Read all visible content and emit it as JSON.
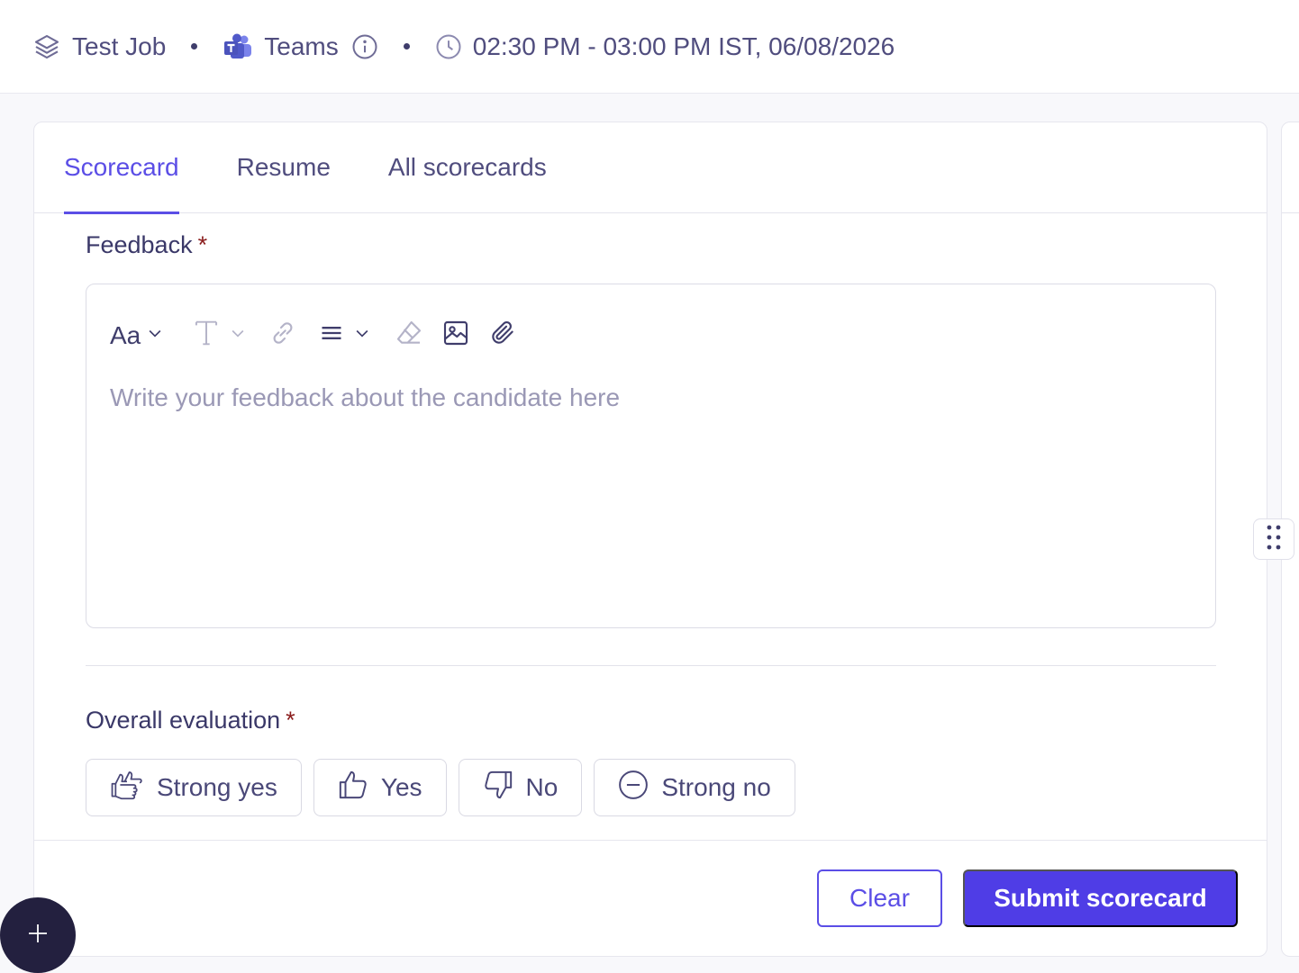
{
  "header": {
    "job_title": "Test Job",
    "meeting_platform": "Teams",
    "schedule": "02:30 PM - 03:00 PM IST, 06/08/2026",
    "icons": [
      "layers-icon",
      "teams-logo-icon",
      "info-icon",
      "clock-icon"
    ]
  },
  "tabs": [
    {
      "label": "Scorecard",
      "active": true
    },
    {
      "label": "Resume",
      "active": false
    },
    {
      "label": "All scorecards",
      "active": false
    }
  ],
  "feedback": {
    "label": "Feedback",
    "required_marker": "*",
    "toolbar": {
      "font_size_label": "Aa",
      "icons": [
        "font-size-icon",
        "text-style-icon",
        "link-icon",
        "align-icon",
        "eraser-icon",
        "image-icon",
        "attachment-icon"
      ]
    },
    "placeholder": "Write your feedback about the candidate here"
  },
  "evaluation": {
    "label": "Overall evaluation",
    "required_marker": "*",
    "options": [
      {
        "label": "Strong yes",
        "icon": "double-thumbs-up-icon"
      },
      {
        "label": "Yes",
        "icon": "thumbs-up-icon"
      },
      {
        "label": "No",
        "icon": "thumbs-down-icon"
      },
      {
        "label": "Strong no",
        "icon": "minus-circle-icon"
      }
    ]
  },
  "actions": {
    "clear_label": "Clear",
    "submit_label": "Submit scorecard"
  },
  "colors": {
    "accent": "#5b4ee6",
    "submit_bg": "#4f3de6",
    "text": "#3f3d6b",
    "required": "#8a1c1c",
    "fab_bg": "#23203f"
  }
}
